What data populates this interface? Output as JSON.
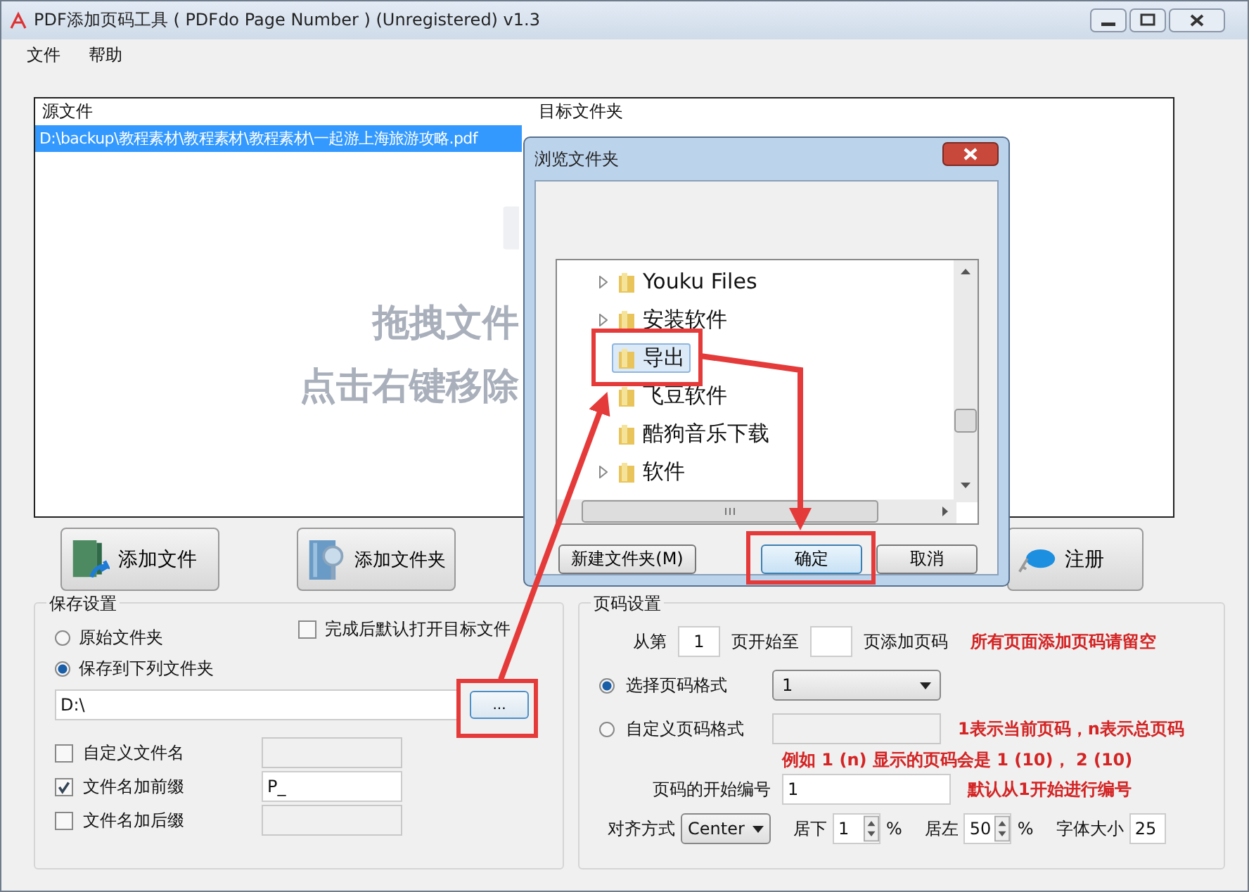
{
  "window": {
    "title": "PDF添加页码工具 ( PDFdo Page Number )  (Unregistered) v1.3"
  },
  "menu": [
    {
      "label": "文件"
    },
    {
      "label": "帮助"
    }
  ],
  "file_list": {
    "columns": [
      "源文件",
      "目标文件夹"
    ],
    "rows": [
      {
        "source": "D:\\backup\\教程素材\\教程素材\\教程素材\\一起游上海旅游攻略.pdf",
        "selected": true
      }
    ],
    "hints": [
      "拖拽文件",
      "点击右键移除"
    ]
  },
  "toolbar": [
    {
      "label": "添加文件",
      "kind": "add-file"
    },
    {
      "label": "添加文件夹",
      "kind": "add-folder"
    },
    {
      "label": "注册",
      "kind": "register"
    }
  ],
  "save_settings": {
    "title": "保存设置",
    "folder_options": [
      {
        "label": "原始文件夹",
        "selected": false
      },
      {
        "label": "保存到下列文件夹",
        "selected": true
      }
    ],
    "open_after": {
      "label": "完成后默认打开目标文件",
      "checked": false
    },
    "folder_path": "D:\\",
    "browse_button": "...",
    "name_options": [
      {
        "label": "自定义文件名",
        "checked": false
      },
      {
        "label": "文件名加前缀",
        "checked": true,
        "value": "P_"
      },
      {
        "label": "文件名加后缀",
        "checked": false
      }
    ]
  },
  "page_settings": {
    "title": "页码设置",
    "range": {
      "from_label": "从第",
      "from": "1",
      "to_label": "页开始至",
      "suffix": "页添加页码",
      "note": "所有页面添加页码请留空"
    },
    "format_options": [
      {
        "label": "选择页码格式",
        "selected": true,
        "kind": "dropdown",
        "value": "1"
      },
      {
        "label": "自定义页码格式",
        "selected": false,
        "kind": "text",
        "note": "1表示当前页码，n表示总页码"
      }
    ],
    "example_note": "例如 1 (n) 显示的页码会是 1 (10)， 2 (10)",
    "start_number": {
      "label": "页码的开始编号",
      "value": "1",
      "note": "默认从1开始进行编号"
    },
    "alignment": {
      "label": "对齐方式",
      "value": "Center"
    },
    "bottom": {
      "label": "居下",
      "value": "1",
      "unit": "%"
    },
    "left": {
      "label": "居左",
      "value": "50",
      "unit": "%"
    },
    "font_size": {
      "label": "字体大小",
      "value": "25"
    }
  },
  "dialog": {
    "title": "浏览文件夹",
    "folders": [
      {
        "label": "Youku Files",
        "has_children": true,
        "selected": false
      },
      {
        "label": "安装软件",
        "has_children": true,
        "selected": false
      },
      {
        "label": "导出",
        "has_children": false,
        "selected": true
      },
      {
        "label": "飞豆软件",
        "has_children": false,
        "selected": false
      },
      {
        "label": "酷狗音乐下载",
        "has_children": false,
        "selected": false
      },
      {
        "label": "软件",
        "has_children": true,
        "selected": false
      }
    ],
    "buttons": [
      {
        "label": "新建文件夹(M)",
        "default": false
      },
      {
        "label": "确定",
        "default": true
      },
      {
        "label": "取消",
        "default": false
      }
    ]
  }
}
